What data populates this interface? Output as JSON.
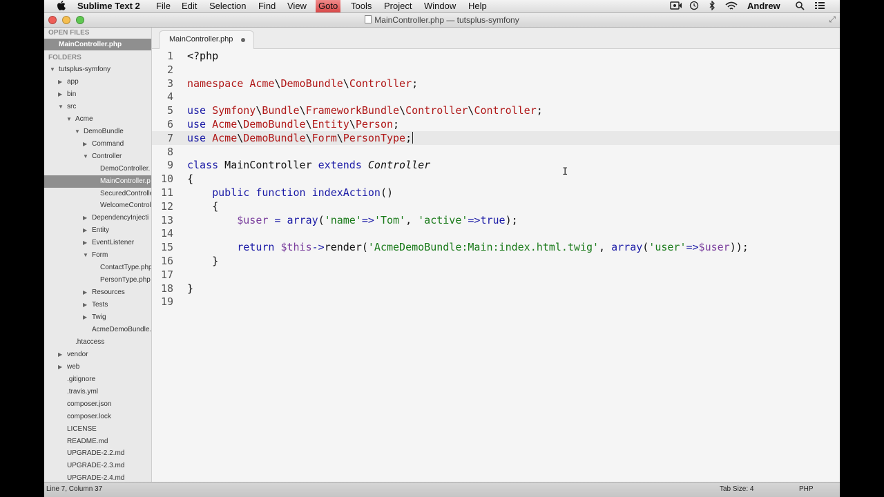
{
  "menubar": {
    "apple": "",
    "app_name": "Sublime Text 2",
    "items": [
      {
        "label": "File"
      },
      {
        "label": "Edit"
      },
      {
        "label": "Selection"
      },
      {
        "label": "Find"
      },
      {
        "label": "View"
      },
      {
        "label": "Goto",
        "highlighted": true
      },
      {
        "label": "Tools"
      },
      {
        "label": "Project"
      },
      {
        "label": "Window"
      },
      {
        "label": "Help"
      }
    ],
    "user": "Andrew"
  },
  "window": {
    "title": "MainController.php — tutsplus-symfony"
  },
  "sidebar": {
    "open_files_heading": "OPEN FILES",
    "open_files": [
      "MainController.php"
    ],
    "folders_heading": "FOLDERS",
    "tree": [
      {
        "label": "tutsplus-symfony",
        "depth": 0,
        "state": "open"
      },
      {
        "label": "app",
        "depth": 1,
        "state": "closed"
      },
      {
        "label": "bin",
        "depth": 1,
        "state": "closed"
      },
      {
        "label": "src",
        "depth": 1,
        "state": "open"
      },
      {
        "label": "Acme",
        "depth": 2,
        "state": "open"
      },
      {
        "label": "DemoBundle",
        "depth": 3,
        "state": "open"
      },
      {
        "label": "Command",
        "depth": 4,
        "state": "closed"
      },
      {
        "label": "Controller",
        "depth": 4,
        "state": "open"
      },
      {
        "label": "DemoController.",
        "depth": 5,
        "state": "file"
      },
      {
        "label": "MainController.p",
        "depth": 5,
        "state": "file",
        "selected": true
      },
      {
        "label": "SecuredControlle",
        "depth": 5,
        "state": "file"
      },
      {
        "label": "WelcomeControl",
        "depth": 5,
        "state": "file"
      },
      {
        "label": "DependencyInjecti",
        "depth": 4,
        "state": "closed"
      },
      {
        "label": "Entity",
        "depth": 4,
        "state": "closed"
      },
      {
        "label": "EventListener",
        "depth": 4,
        "state": "closed"
      },
      {
        "label": "Form",
        "depth": 4,
        "state": "open"
      },
      {
        "label": "ContactType.php",
        "depth": 5,
        "state": "file"
      },
      {
        "label": "PersonType.php",
        "depth": 5,
        "state": "file"
      },
      {
        "label": "Resources",
        "depth": 4,
        "state": "closed"
      },
      {
        "label": "Tests",
        "depth": 4,
        "state": "closed"
      },
      {
        "label": "Twig",
        "depth": 4,
        "state": "closed"
      },
      {
        "label": "AcmeDemoBundle.",
        "depth": 4,
        "state": "file"
      },
      {
        "label": ".htaccess",
        "depth": 2,
        "state": "file"
      },
      {
        "label": "vendor",
        "depth": 1,
        "state": "closed"
      },
      {
        "label": "web",
        "depth": 1,
        "state": "closed"
      },
      {
        "label": ".gitignore",
        "depth": 1,
        "state": "file"
      },
      {
        "label": ".travis.yml",
        "depth": 1,
        "state": "file"
      },
      {
        "label": "composer.json",
        "depth": 1,
        "state": "file"
      },
      {
        "label": "composer.lock",
        "depth": 1,
        "state": "file"
      },
      {
        "label": "LICENSE",
        "depth": 1,
        "state": "file"
      },
      {
        "label": "README.md",
        "depth": 1,
        "state": "file"
      },
      {
        "label": "UPGRADE-2.2.md",
        "depth": 1,
        "state": "file"
      },
      {
        "label": "UPGRADE-2.3.md",
        "depth": 1,
        "state": "file"
      },
      {
        "label": "UPGRADE-2.4.md",
        "depth": 1,
        "state": "file"
      }
    ]
  },
  "tabs": [
    {
      "label": "MainController.php",
      "modified": true
    }
  ],
  "editor": {
    "current_line": 7,
    "lines": [
      [
        {
          "t": "<?php",
          "c": "plain"
        }
      ],
      [],
      [
        {
          "t": "namespace",
          "c": "kw_red"
        },
        {
          "t": " ",
          "c": "plain"
        },
        {
          "t": "Acme",
          "c": "ns"
        },
        {
          "t": "\\",
          "c": "plain"
        },
        {
          "t": "DemoBundle",
          "c": "ns"
        },
        {
          "t": "\\",
          "c": "plain"
        },
        {
          "t": "Controller",
          "c": "ns"
        },
        {
          "t": ";",
          "c": "plain"
        }
      ],
      [],
      [
        {
          "t": "use",
          "c": "kw"
        },
        {
          "t": " ",
          "c": "plain"
        },
        {
          "t": "Symfony",
          "c": "ns"
        },
        {
          "t": "\\",
          "c": "plain"
        },
        {
          "t": "Bundle",
          "c": "ns"
        },
        {
          "t": "\\",
          "c": "plain"
        },
        {
          "t": "FrameworkBundle",
          "c": "ns"
        },
        {
          "t": "\\",
          "c": "plain"
        },
        {
          "t": "Controller",
          "c": "ns"
        },
        {
          "t": "\\",
          "c": "plain"
        },
        {
          "t": "Controller",
          "c": "ns"
        },
        {
          "t": ";",
          "c": "plain"
        }
      ],
      [
        {
          "t": "use",
          "c": "kw"
        },
        {
          "t": " ",
          "c": "plain"
        },
        {
          "t": "Acme",
          "c": "ns"
        },
        {
          "t": "\\",
          "c": "plain"
        },
        {
          "t": "DemoBundle",
          "c": "ns"
        },
        {
          "t": "\\",
          "c": "plain"
        },
        {
          "t": "Entity",
          "c": "ns"
        },
        {
          "t": "\\",
          "c": "plain"
        },
        {
          "t": "Person",
          "c": "ns"
        },
        {
          "t": ";",
          "c": "plain"
        }
      ],
      [
        {
          "t": "use",
          "c": "kw"
        },
        {
          "t": " ",
          "c": "plain"
        },
        {
          "t": "Acme",
          "c": "ns"
        },
        {
          "t": "\\",
          "c": "plain"
        },
        {
          "t": "DemoBundle",
          "c": "ns"
        },
        {
          "t": "\\",
          "c": "plain"
        },
        {
          "t": "Form",
          "c": "ns"
        },
        {
          "t": "\\",
          "c": "plain"
        },
        {
          "t": "PersonType",
          "c": "ns"
        },
        {
          "t": ";",
          "c": "plain"
        }
      ],
      [],
      [
        {
          "t": "class",
          "c": "kw"
        },
        {
          "t": " MainController ",
          "c": "plain"
        },
        {
          "t": "extends",
          "c": "kw"
        },
        {
          "t": " ",
          "c": "plain"
        },
        {
          "t": "Controller",
          "c": "italic"
        }
      ],
      [
        {
          "t": "{",
          "c": "plain"
        }
      ],
      [
        {
          "t": "    ",
          "c": "plain"
        },
        {
          "t": "public",
          "c": "kw"
        },
        {
          "t": " ",
          "c": "plain"
        },
        {
          "t": "function",
          "c": "kw"
        },
        {
          "t": " ",
          "c": "plain"
        },
        {
          "t": "indexAction",
          "c": "func"
        },
        {
          "t": "()",
          "c": "plain"
        }
      ],
      [
        {
          "t": "    {",
          "c": "plain"
        }
      ],
      [
        {
          "t": "        ",
          "c": "plain"
        },
        {
          "t": "$user",
          "c": "var"
        },
        {
          "t": " ",
          "c": "plain"
        },
        {
          "t": "=",
          "c": "kw"
        },
        {
          "t": " ",
          "c": "plain"
        },
        {
          "t": "array",
          "c": "func"
        },
        {
          "t": "(",
          "c": "plain"
        },
        {
          "t": "'name'",
          "c": "str"
        },
        {
          "t": "=>",
          "c": "kw"
        },
        {
          "t": "'Tom'",
          "c": "str"
        },
        {
          "t": ", ",
          "c": "plain"
        },
        {
          "t": "'active'",
          "c": "str"
        },
        {
          "t": "=>",
          "c": "kw"
        },
        {
          "t": "true",
          "c": "kw"
        },
        {
          "t": ");",
          "c": "plain"
        }
      ],
      [],
      [
        {
          "t": "        ",
          "c": "plain"
        },
        {
          "t": "return",
          "c": "kw"
        },
        {
          "t": " ",
          "c": "plain"
        },
        {
          "t": "$this",
          "c": "var"
        },
        {
          "t": "->",
          "c": "kw"
        },
        {
          "t": "render(",
          "c": "plain"
        },
        {
          "t": "'AcmeDemoBundle:Main:index.html.twig'",
          "c": "str"
        },
        {
          "t": ", ",
          "c": "plain"
        },
        {
          "t": "array",
          "c": "func"
        },
        {
          "t": "(",
          "c": "plain"
        },
        {
          "t": "'user'",
          "c": "str"
        },
        {
          "t": "=>",
          "c": "kw"
        },
        {
          "t": "$user",
          "c": "var"
        },
        {
          "t": "));",
          "c": "plain"
        }
      ],
      [
        {
          "t": "    }",
          "c": "plain"
        }
      ],
      [],
      [
        {
          "t": "}",
          "c": "plain"
        }
      ],
      []
    ]
  },
  "statusbar": {
    "position": "Line 7, Column 37",
    "tab_size": "Tab Size: 4",
    "syntax": "PHP"
  },
  "colors": {
    "kw": "#1a1aa6",
    "kw_red": "#b01818",
    "ns": "#b01818",
    "func": "#1a1aa6",
    "str": "#1a7a1a",
    "var": "#7a3e9d",
    "plain": "#111111",
    "italic": "#111111"
  }
}
